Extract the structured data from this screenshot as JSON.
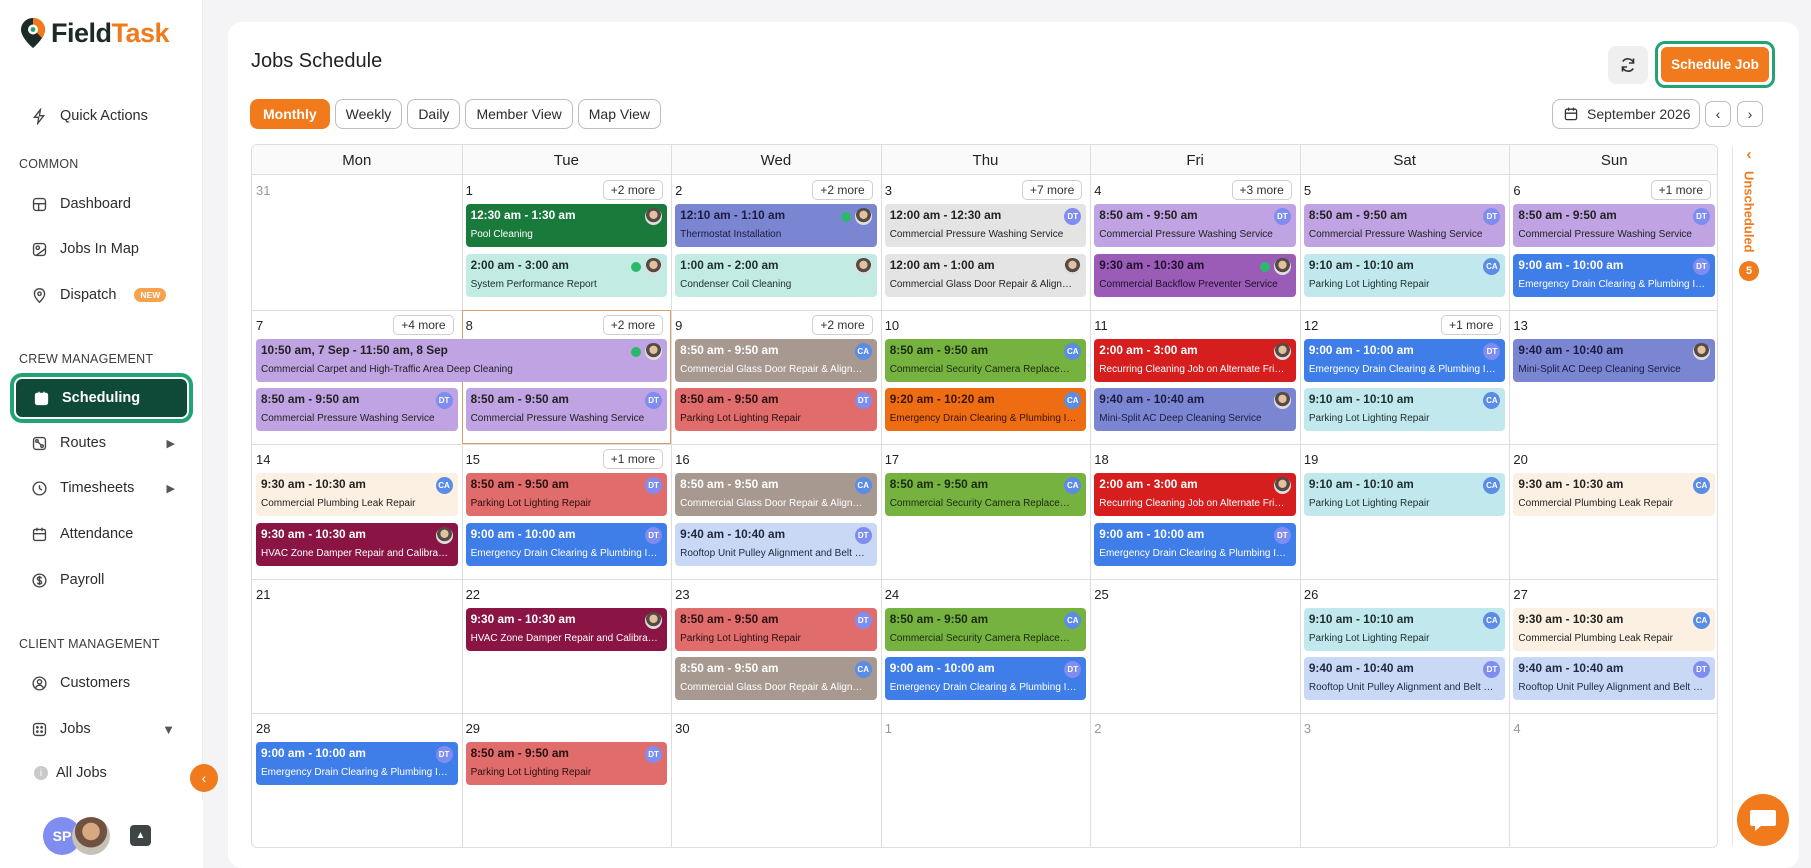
{
  "brand": {
    "name_part1": "Field",
    "name_part2": "Task",
    "accent": "#f07a1c",
    "dark": "#0f4a38"
  },
  "sidebar": {
    "quick_actions": "Quick Actions",
    "common_label": "COMMON",
    "dashboard": "Dashboard",
    "jobs_in_map": "Jobs In Map",
    "dispatch": "Dispatch",
    "dispatch_badge": "NEW",
    "crew_label": "CREW MANAGEMENT",
    "scheduling": "Scheduling",
    "routes": "Routes",
    "timesheets": "Timesheets",
    "attendance": "Attendance",
    "payroll": "Payroll",
    "client_label": "CLIENT MANAGEMENT",
    "customers": "Customers",
    "jobs": "Jobs",
    "all_jobs": "All Jobs",
    "user_initials": "SP"
  },
  "header": {
    "title": "Jobs Schedule",
    "schedule_button": "Schedule Job",
    "month": "September 2026",
    "views": [
      "Monthly",
      "Weekly",
      "Daily",
      "Member View",
      "Map View"
    ],
    "selected_view": "Monthly"
  },
  "calendar": {
    "weekdays": [
      "Mon",
      "Tue",
      "Wed",
      "Thu",
      "Fri",
      "Sat",
      "Sun"
    ],
    "weeks": [
      [
        {
          "day": "31",
          "dim": true,
          "events": []
        },
        {
          "day": "1",
          "more": "+2 more",
          "events": [
            {
              "time": "12:30 am - 1:30 am",
              "desc": "Pool Cleaning",
              "color": "green",
              "avatar": "photo"
            },
            {
              "time": "2:00 am - 3:00 am",
              "desc": "System Performance Report",
              "color": "mint",
              "avatar": "photo",
              "check": true
            }
          ]
        },
        {
          "day": "2",
          "more": "+2 more",
          "events": [
            {
              "time": "12:10 am - 1:10 am",
              "desc": "Thermostat Installation",
              "color": "indigo",
              "avatar": "photo",
              "check": true
            },
            {
              "time": "1:00 am - 2:00 am",
              "desc": "Condenser Coil Cleaning",
              "color": "mint",
              "avatar": "photo"
            }
          ]
        },
        {
          "day": "3",
          "more": "+7 more",
          "events": [
            {
              "time": "12:00 am - 12:30 am",
              "desc": "Commercial Pressure Washing Service",
              "color": "gray",
              "avatar": "DT"
            },
            {
              "time": "12:00 am - 1:00 am",
              "desc": "Commercial Glass Door Repair & Alignment",
              "color": "gray",
              "avatar": "photo"
            }
          ]
        },
        {
          "day": "4",
          "more": "+3 more",
          "events": [
            {
              "time": "8:50 am - 9:50 am",
              "desc": "Commercial Pressure Washing Service",
              "color": "lpurple",
              "avatar": "DT"
            },
            {
              "time": "9:30 am - 10:30 am",
              "desc": "Commercial Backflow Preventer Service",
              "color": "magenta",
              "avatar": "photo",
              "check": true
            }
          ]
        },
        {
          "day": "5",
          "events": [
            {
              "time": "8:50 am - 9:50 am",
              "desc": "Commercial Pressure Washing Service",
              "color": "lpurple",
              "avatar": "DT"
            },
            {
              "time": "9:10 am - 10:10 am",
              "desc": "Parking Lot Lighting Repair",
              "color": "cyan",
              "avatar": "CA"
            }
          ]
        },
        {
          "day": "6",
          "more": "+1 more",
          "events": [
            {
              "time": "8:50 am - 9:50 am",
              "desc": "Commercial Pressure Washing Service",
              "color": "lpurple",
              "avatar": "DT"
            },
            {
              "time": "9:00 am - 10:00 am",
              "desc": "Emergency Drain Clearing & Plumbing Inspection",
              "color": "blue",
              "avatar": "DT"
            }
          ]
        }
      ],
      [
        {
          "day": "7",
          "more": "+4 more",
          "events": [
            {
              "time": "8:50 am - 9:50 am",
              "desc": "Commercial Pressure Washing Service",
              "color": "lpurple",
              "avatar": "DT",
              "slot": 1
            }
          ]
        },
        {
          "day": "8",
          "more": "+2 more",
          "today": true,
          "events": [
            {
              "time": "8:50 am - 9:50 am",
              "desc": "Commercial Pressure Washing Service",
              "color": "lpurple",
              "avatar": "DT",
              "slot": 1
            }
          ]
        },
        {
          "day": "9",
          "more": "+2 more",
          "events": [
            {
              "time": "8:50 am - 9:50 am",
              "desc": "Commercial Glass Door Repair & Alignment",
              "color": "grayb",
              "avatar": "CA"
            },
            {
              "time": "8:50 am - 9:50 am",
              "desc": "Parking Lot Lighting Repair",
              "color": "salmon",
              "avatar": "DT"
            }
          ]
        },
        {
          "day": "10",
          "events": [
            {
              "time": "8:50 am - 9:50 am",
              "desc": "Commercial Security Camera Replacement",
              "color": "lime",
              "avatar": "CA"
            },
            {
              "time": "9:20 am - 10:20 am",
              "desc": "Emergency Drain Clearing & Plumbing Inspection",
              "color": "orange",
              "avatar": "CA"
            }
          ]
        },
        {
          "day": "11",
          "events": [
            {
              "time": "2:00 am - 3:00 am",
              "desc": "Recurring Cleaning Job on Alternate Fridays",
              "color": "red",
              "avatar": "photo"
            },
            {
              "time": "9:40 am - 10:40 am",
              "desc": "Mini-Split AC Deep Cleaning Service",
              "color": "indigo",
              "avatar": "photo"
            }
          ]
        },
        {
          "day": "12",
          "more": "+1 more",
          "events": [
            {
              "time": "9:00 am - 10:00 am",
              "desc": "Emergency Drain Clearing & Plumbing Inspection",
              "color": "blue",
              "avatar": "DT"
            },
            {
              "time": "9:10 am - 10:10 am",
              "desc": "Parking Lot Lighting Repair",
              "color": "cyan",
              "avatar": "CA"
            }
          ]
        },
        {
          "day": "13",
          "events": [
            {
              "time": "9:40 am - 10:40 am",
              "desc": "Mini-Split AC Deep Cleaning Service",
              "color": "indigo",
              "avatar": "photo"
            }
          ]
        }
      ],
      [
        {
          "day": "14",
          "events": [
            {
              "time": "9:30 am - 10:30 am",
              "desc": "Commercial Plumbing Leak Repair",
              "color": "cream",
              "avatar": "CA"
            },
            {
              "time": "9:30 am - 10:30 am",
              "desc": "HVAC Zone Damper Repair and Calibration",
              "color": "maroon",
              "avatar": "photo"
            }
          ]
        },
        {
          "day": "15",
          "more": "+1 more",
          "events": [
            {
              "time": "8:50 am - 9:50 am",
              "desc": "Parking Lot Lighting Repair",
              "color": "salmon",
              "avatar": "DT"
            },
            {
              "time": "9:00 am - 10:00 am",
              "desc": "Emergency Drain Clearing & Plumbing Inspection",
              "color": "blue",
              "avatar": "DT"
            }
          ]
        },
        {
          "day": "16",
          "events": [
            {
              "time": "8:50 am - 9:50 am",
              "desc": "Commercial Glass Door Repair & Alignment",
              "color": "grayb",
              "avatar": "CA"
            },
            {
              "time": "9:40 am - 10:40 am",
              "desc": "Rooftop Unit Pulley Alignment and Belt Service",
              "color": "sky",
              "avatar": "DT"
            }
          ]
        },
        {
          "day": "17",
          "events": [
            {
              "time": "8:50 am - 9:50 am",
              "desc": "Commercial Security Camera Replacement",
              "color": "lime",
              "avatar": "CA"
            }
          ]
        },
        {
          "day": "18",
          "events": [
            {
              "time": "2:00 am - 3:00 am",
              "desc": "Recurring Cleaning Job on Alternate Fridays",
              "color": "red",
              "avatar": "photo"
            },
            {
              "time": "9:00 am - 10:00 am",
              "desc": "Emergency Drain Clearing & Plumbing Inspection",
              "color": "blue",
              "avatar": "DT"
            }
          ]
        },
        {
          "day": "19",
          "events": [
            {
              "time": "9:10 am - 10:10 am",
              "desc": "Parking Lot Lighting Repair",
              "color": "cyan",
              "avatar": "CA"
            }
          ]
        },
        {
          "day": "20",
          "events": [
            {
              "time": "9:30 am - 10:30 am",
              "desc": "Commercial Plumbing Leak Repair",
              "color": "cream",
              "avatar": "CA"
            }
          ]
        }
      ],
      [
        {
          "day": "21",
          "events": []
        },
        {
          "day": "22",
          "events": [
            {
              "time": "9:30 am - 10:30 am",
              "desc": "HVAC Zone Damper Repair and Calibration",
              "color": "maroon",
              "avatar": "photo"
            }
          ]
        },
        {
          "day": "23",
          "events": [
            {
              "time": "8:50 am - 9:50 am",
              "desc": "Parking Lot Lighting Repair",
              "color": "salmon",
              "avatar": "DT"
            },
            {
              "time": "8:50 am - 9:50 am",
              "desc": "Commercial Glass Door Repair & Alignment",
              "color": "grayb",
              "avatar": "CA"
            }
          ]
        },
        {
          "day": "24",
          "events": [
            {
              "time": "8:50 am - 9:50 am",
              "desc": "Commercial Security Camera Replacement",
              "color": "lime",
              "avatar": "CA"
            },
            {
              "time": "9:00 am - 10:00 am",
              "desc": "Emergency Drain Clearing & Plumbing Inspection",
              "color": "blue",
              "avatar": "DT"
            }
          ]
        },
        {
          "day": "25",
          "events": []
        },
        {
          "day": "26",
          "events": [
            {
              "time": "9:10 am - 10:10 am",
              "desc": "Parking Lot Lighting Repair",
              "color": "cyan",
              "avatar": "CA"
            },
            {
              "time": "9:40 am - 10:40 am",
              "desc": "Rooftop Unit Pulley Alignment and Belt Service",
              "color": "sky",
              "avatar": "DT"
            }
          ]
        },
        {
          "day": "27",
          "events": [
            {
              "time": "9:30 am - 10:30 am",
              "desc": "Commercial Plumbing Leak Repair",
              "color": "cream",
              "avatar": "CA"
            },
            {
              "time": "9:40 am - 10:40 am",
              "desc": "Rooftop Unit Pulley Alignment and Belt Service",
              "color": "sky",
              "avatar": "DT"
            }
          ]
        }
      ],
      [
        {
          "day": "28",
          "events": [
            {
              "time": "9:00 am - 10:00 am",
              "desc": "Emergency Drain Clearing & Plumbing Inspection",
              "color": "blue",
              "avatar": "DT"
            }
          ]
        },
        {
          "day": "29",
          "events": [
            {
              "time": "8:50 am - 9:50 am",
              "desc": "Parking Lot Lighting Repair",
              "color": "salmon",
              "avatar": "DT"
            }
          ]
        },
        {
          "day": "30",
          "events": []
        },
        {
          "day": "1",
          "dim": true,
          "events": []
        },
        {
          "day": "2",
          "dim": true,
          "events": []
        },
        {
          "day": "3",
          "dim": true,
          "events": []
        },
        {
          "day": "4",
          "dim": true,
          "events": []
        }
      ]
    ],
    "spanning_event": {
      "time": "10:50 am, 7 Sep - 11:50 am, 8 Sep",
      "desc": "Commercial Carpet and High-Traffic Area Deep Cleaning",
      "color": "lpurple",
      "avatar": "photo",
      "check": true
    }
  },
  "unscheduled": {
    "label": "Unscheduled",
    "count": "5"
  }
}
